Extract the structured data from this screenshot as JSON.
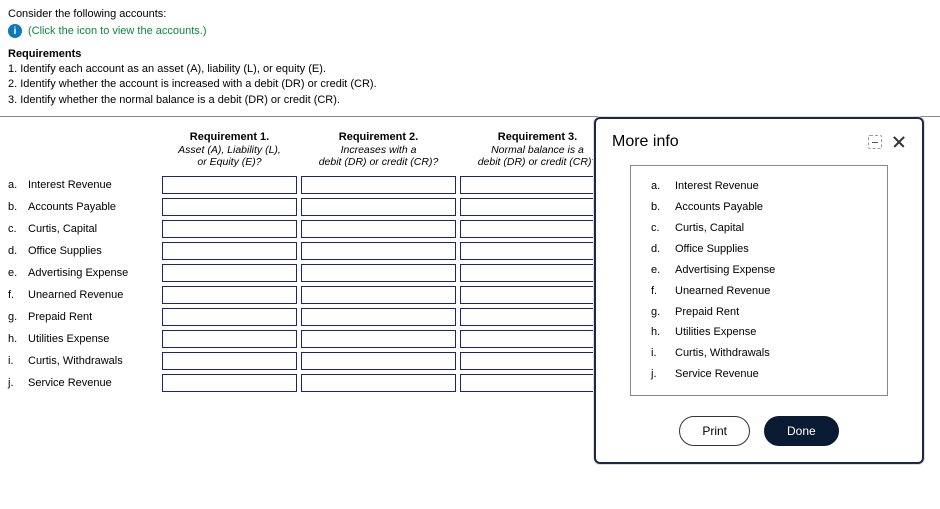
{
  "intro": "Consider the following accounts:",
  "linkText": "(Click the icon to view the accounts.)",
  "requirementsTitle": "Requirements",
  "requirements": [
    "1. Identify each account as an asset (A), liability (L), or equity (E).",
    "2. Identify whether the account is increased with a debit (DR) or credit (CR).",
    "3. Identify whether the normal balance is a debit (DR) or credit (CR)."
  ],
  "headers": {
    "r1": {
      "title": "Requirement 1.",
      "sub1": "Asset (A), Liability (L),",
      "sub2": "or Equity (E)?"
    },
    "r2": {
      "title": "Requirement 2.",
      "sub1": "Increases with a",
      "sub2": "debit (DR) or credit (CR)?"
    },
    "r3": {
      "title": "Requirement 3.",
      "sub1": "Normal balance is a",
      "sub2": "debit (DR) or credit (CR)?"
    }
  },
  "rows": [
    {
      "letter": "a.",
      "name": "Interest Revenue"
    },
    {
      "letter": "b.",
      "name": "Accounts Payable"
    },
    {
      "letter": "c.",
      "name": "Curtis, Capital"
    },
    {
      "letter": "d.",
      "name": "Office Supplies"
    },
    {
      "letter": "e.",
      "name": "Advertising Expense"
    },
    {
      "letter": "f.",
      "name": "Unearned Revenue"
    },
    {
      "letter": "g.",
      "name": "Prepaid Rent"
    },
    {
      "letter": "h.",
      "name": "Utilities Expense"
    },
    {
      "letter": "i.",
      "name": "Curtis, Withdrawals"
    },
    {
      "letter": "j.",
      "name": "Service Revenue"
    }
  ],
  "modal": {
    "title": "More info",
    "items": [
      {
        "letter": "a.",
        "name": "Interest Revenue"
      },
      {
        "letter": "b.",
        "name": "Accounts Payable"
      },
      {
        "letter": "c.",
        "name": "Curtis, Capital"
      },
      {
        "letter": "d.",
        "name": "Office Supplies"
      },
      {
        "letter": "e.",
        "name": "Advertising Expense"
      },
      {
        "letter": "f.",
        "name": "Unearned Revenue"
      },
      {
        "letter": "g.",
        "name": "Prepaid Rent"
      },
      {
        "letter": "h.",
        "name": "Utilities Expense"
      },
      {
        "letter": "i.",
        "name": "Curtis, Withdrawals"
      },
      {
        "letter": "j.",
        "name": "Service Revenue"
      }
    ],
    "print": "Print",
    "done": "Done"
  }
}
